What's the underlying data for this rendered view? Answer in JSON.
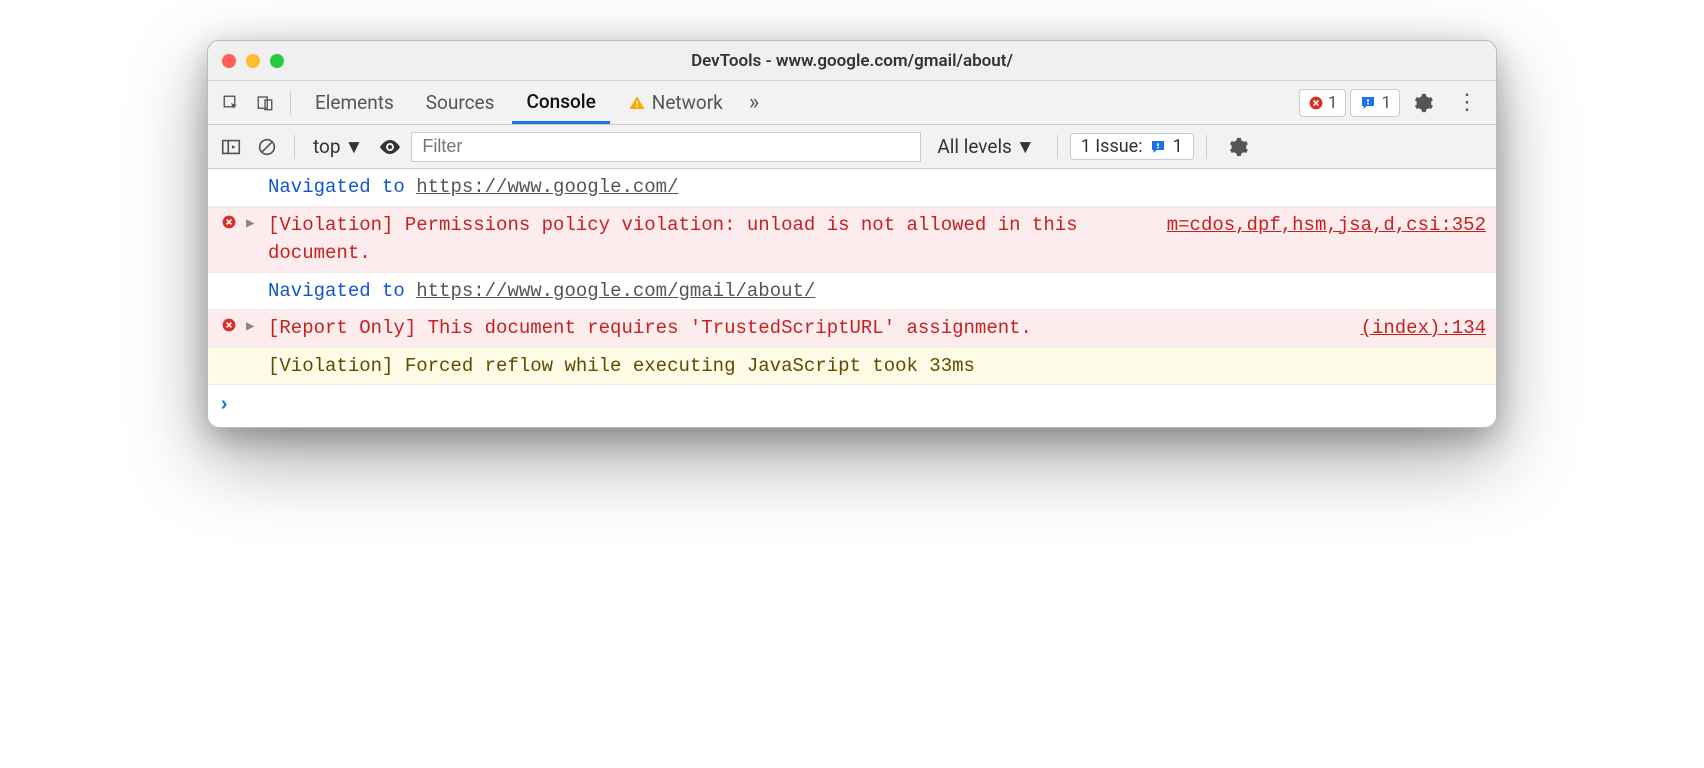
{
  "window": {
    "title": "DevTools - www.google.com/gmail/about/"
  },
  "tabs": {
    "items": [
      "Elements",
      "Sources",
      "Console",
      "Network"
    ],
    "active": "Console"
  },
  "tabbar_badges": {
    "errors_count": "1",
    "issues_count": "1"
  },
  "console_toolbar": {
    "context": "top",
    "filter_placeholder": "Filter",
    "levels_label": "All levels",
    "issues_label": "1 Issue:",
    "issues_count": "1"
  },
  "messages": [
    {
      "type": "nav",
      "prefix": "Navigated to ",
      "url": "https://www.google.com/"
    },
    {
      "type": "err",
      "expandable": true,
      "text": "[Violation] Permissions policy violation: unload is not allowed in this document.",
      "source": "m=cdos,dpf,hsm,jsa,d,csi:352"
    },
    {
      "type": "nav",
      "prefix": "Navigated to ",
      "url": "https://www.google.com/gmail/about/"
    },
    {
      "type": "err",
      "expandable": true,
      "text": "[Report Only] This document requires 'TrustedScriptURL' assignment.",
      "source": "(index):134"
    },
    {
      "type": "warn",
      "text": "[Violation] Forced reflow while executing JavaScript took 33ms"
    }
  ]
}
